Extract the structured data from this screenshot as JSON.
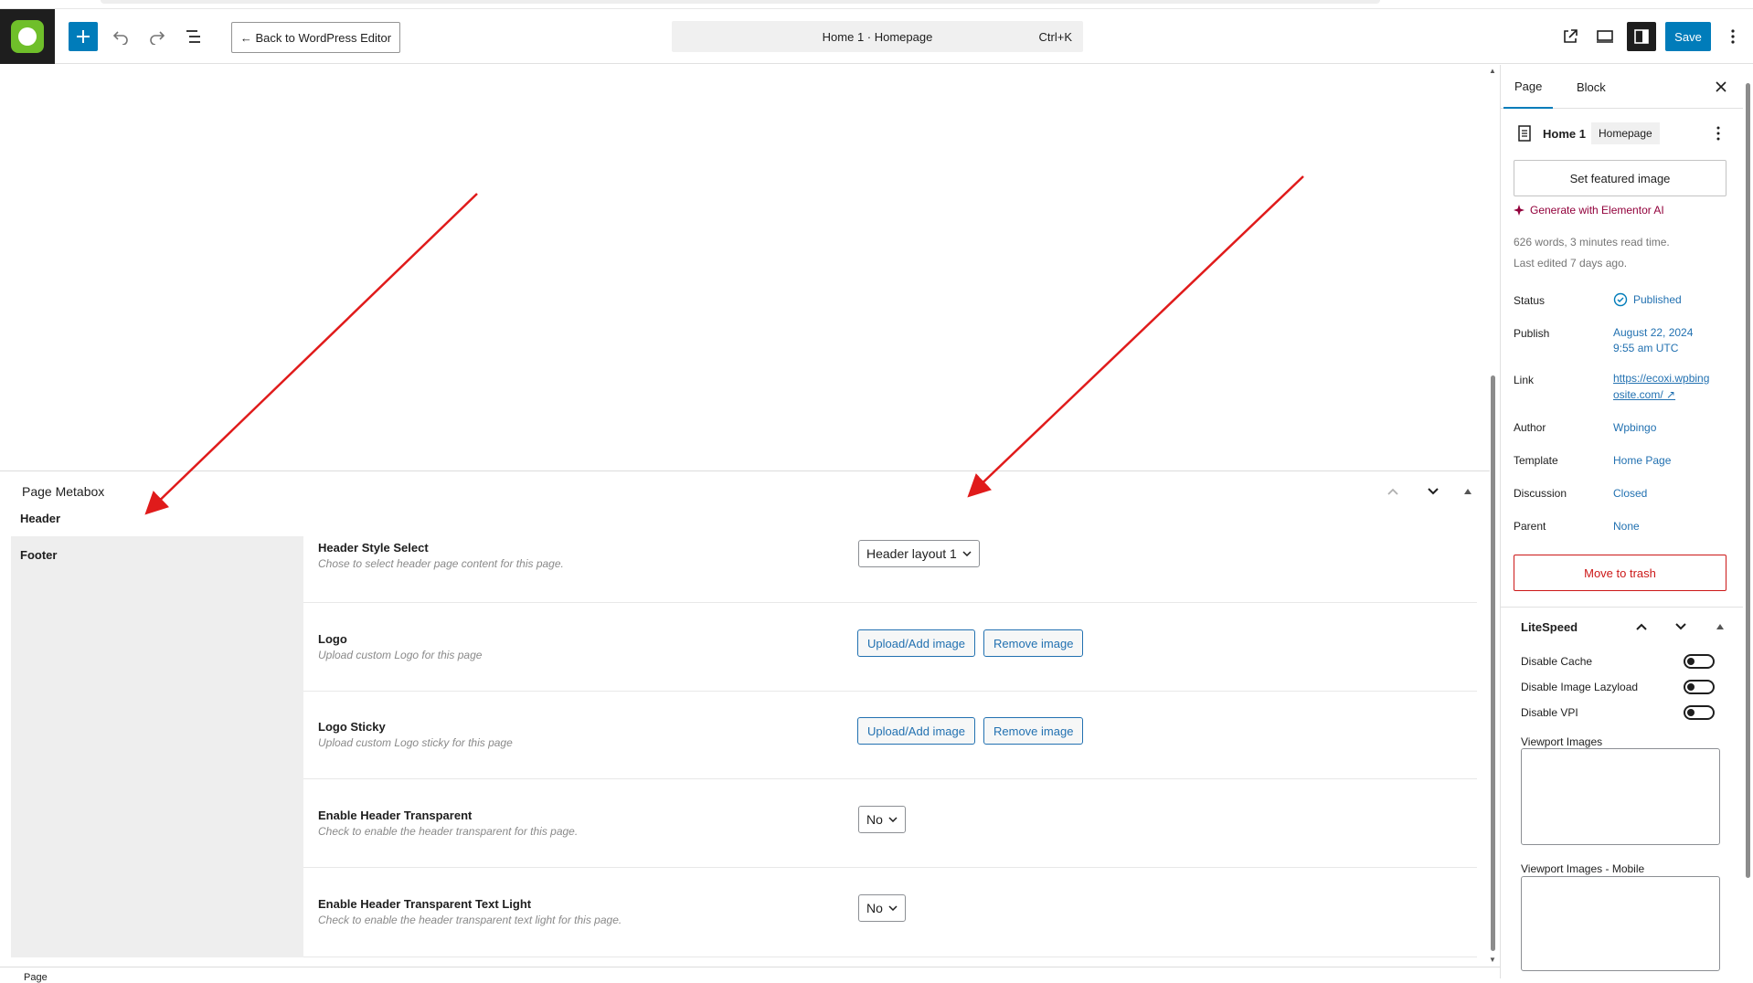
{
  "toolbar": {
    "back_label": "← Back to WordPress Editor",
    "command_title": "Home 1 · Homepage",
    "command_shortcut": "Ctrl+K",
    "save_label": "Save"
  },
  "metabox": {
    "title": "Page Metabox",
    "tabs": [
      {
        "label": "Header"
      },
      {
        "label": "Footer"
      }
    ],
    "fields": [
      {
        "label": "Header Style Select",
        "desc": "Chose to select header page content for this page.",
        "control": "Header layout 1"
      },
      {
        "label": "Logo",
        "desc": "Upload custom Logo for this page",
        "upload": "Upload/Add image",
        "remove": "Remove image"
      },
      {
        "label": "Logo Sticky",
        "desc": "Upload custom Logo sticky for this page",
        "upload": "Upload/Add image",
        "remove": "Remove image"
      },
      {
        "label": "Enable Header Transparent",
        "desc": "Check to enable the header transparent for this page.",
        "control": "No"
      },
      {
        "label": "Enable Header Transparent Text Light",
        "desc": "Check to enable the header transparent text light for this page.",
        "control": "No"
      }
    ]
  },
  "footer": {
    "breadcrumb": "Page"
  },
  "sidebar": {
    "tabs": [
      {
        "label": "Page"
      },
      {
        "label": "Block"
      }
    ],
    "page_title": "Home 1",
    "page_badge": "Homepage",
    "featured_image": "Set featured image",
    "elementor_ai": "Generate with Elementor AI",
    "stats_line1": "626 words, 3 minutes read time.",
    "stats_line2": "Last edited 7 days ago.",
    "props": {
      "status_label": "Status",
      "status_value": "Published",
      "publish_label": "Publish",
      "publish_value_1": "August 22, 2024",
      "publish_value_2": "9:55 am UTC",
      "link_label": "Link",
      "link_value_1": "https://ecoxi.wpbing",
      "link_value_2": "osite.com/ ↗",
      "author_label": "Author",
      "author_value": "Wpbingo",
      "template_label": "Template",
      "template_value": "Home Page",
      "discussion_label": "Discussion",
      "discussion_value": "Closed",
      "parent_label": "Parent",
      "parent_value": "None"
    },
    "trash": "Move to trash",
    "litespeed": {
      "title": "LiteSpeed",
      "disable_cache": "Disable Cache",
      "disable_lazyload": "Disable Image Lazyload",
      "disable_vpi": "Disable VPI",
      "viewport_images": "Viewport Images",
      "viewport_images_mobile": "Viewport Images - Mobile"
    }
  },
  "colors": {
    "accent": "#007cba",
    "annotation": "#e01b1b",
    "danger": "#cc1818",
    "elementor": "#92003b"
  }
}
